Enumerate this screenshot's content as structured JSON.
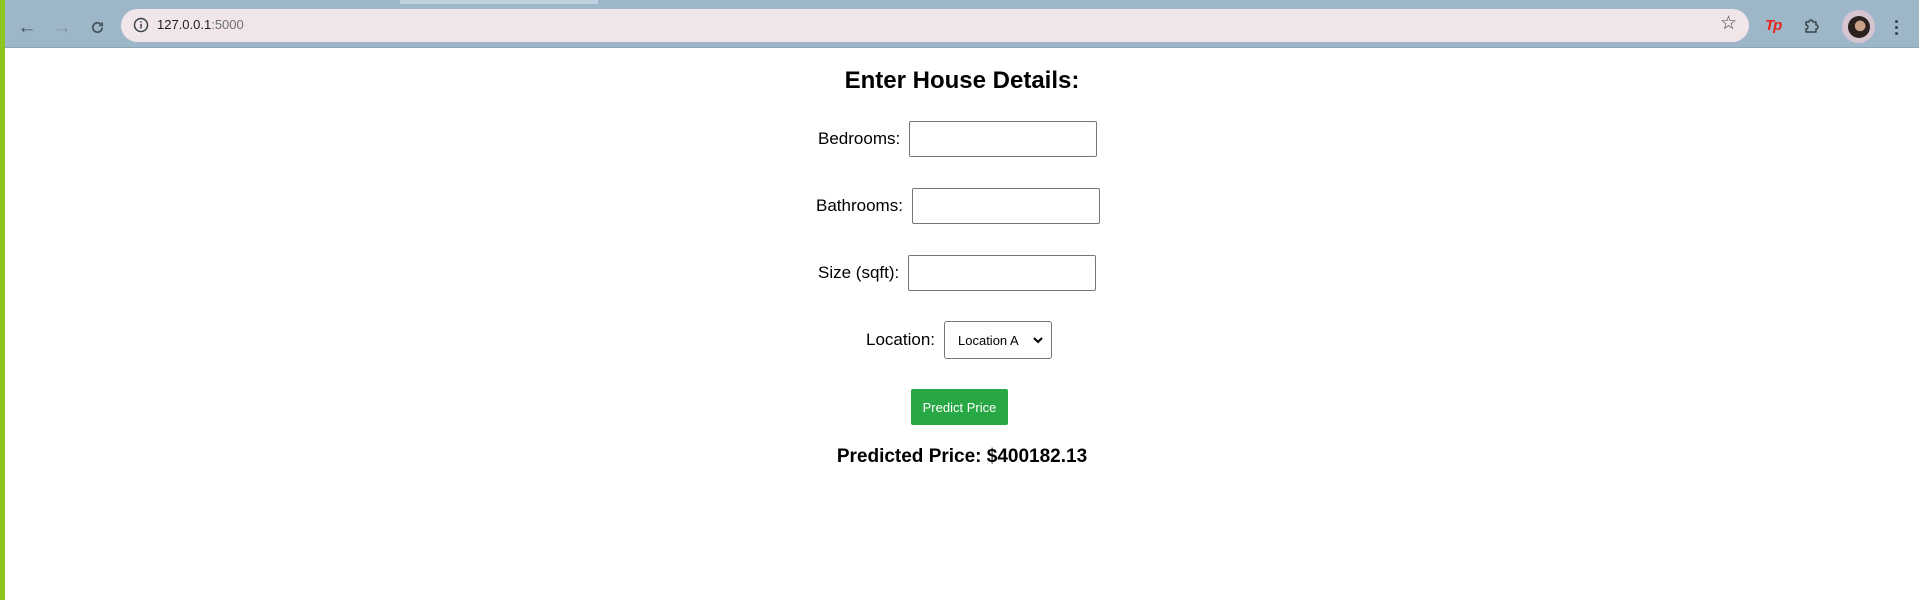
{
  "browser": {
    "url_host": "127.0.0.1",
    "url_port": ":5000",
    "extension_label": "Tp",
    "icons": [
      "back-arrow-icon",
      "forward-arrow-icon",
      "reload-icon",
      "site-info-icon",
      "bookmark-star-icon",
      "extension-tp-icon",
      "extensions-puzzle-icon",
      "profile-avatar",
      "kebab-menu-icon"
    ]
  },
  "form": {
    "heading": "Enter House Details:",
    "bedrooms_label": "Bedrooms:",
    "bedrooms_value": "",
    "bathrooms_label": "Bathrooms:",
    "bathrooms_value": "",
    "size_label": "Size (sqft):",
    "size_value": "",
    "location_label": "Location:",
    "location_selected": "Location A",
    "submit_label": "Predict Price",
    "result_text": "Predicted Price: $400182.13"
  },
  "colors": {
    "accent_button": "#28a745",
    "toolbar": "#9db7c9",
    "omnibox": "#f0e6ea",
    "desktop_edge": "#8dc51f"
  }
}
